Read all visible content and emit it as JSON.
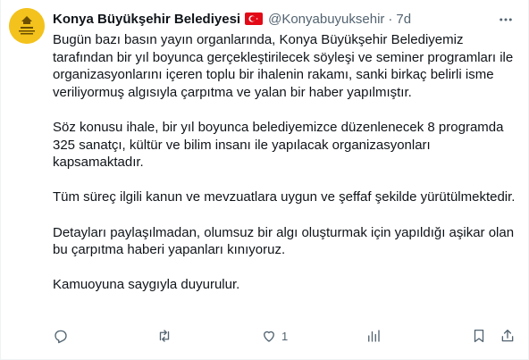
{
  "tweet": {
    "author_name": "Konya Büyükşehir Belediyesi",
    "handle": "@Konyabuyuksehir",
    "separator": "·",
    "time": "7d",
    "paragraphs": [
      "Bugün bazı basın yayın organlarında, Konya Büyükşehir Belediyemiz tarafından bir yıl boyunca gerçekleştirilecek söyleşi ve seminer programları ile organizasyonlarını içeren toplu bir ihalenin rakamı, sanki birkaç belirli isme veriliyormuş algısıyla çarpıtma ve yalan bir haber yapılmıştır.",
      "Söz konusu ihale, bir yıl boyunca belediyemizce düzenlenecek 8 programda 325 sanatçı, kültür ve bilim insanı ile yapılacak organizasyonları kapsamaktadır.",
      "Tüm süreç ilgili kanun ve mevzuatlara uygun ve şeffaf şekilde yürütülmektedir.",
      "Detayları paylaşılmadan, olumsuz bir algı oluşturmak için yapıldığı aşikar olan bu çarpıtma haberi yapanları kınıyoruz.",
      "Kamuoyuna saygıyla duyurulur."
    ],
    "actions": {
      "reply_icon": "reply-icon",
      "retweet_icon": "retweet-icon",
      "like_icon": "like-icon",
      "like_count": "1",
      "stats_icon": "analytics-icon",
      "bookmark_icon": "bookmark-icon",
      "share_icon": "share-icon"
    },
    "icons": {
      "avatar": "municipality-logo",
      "flag": "turkey-flag",
      "more": "more-options-icon"
    },
    "colors": {
      "text": "#0f1419",
      "secondary": "#536471",
      "avatar_bg": "#f3c21c",
      "flag_red": "#e30a17"
    }
  }
}
